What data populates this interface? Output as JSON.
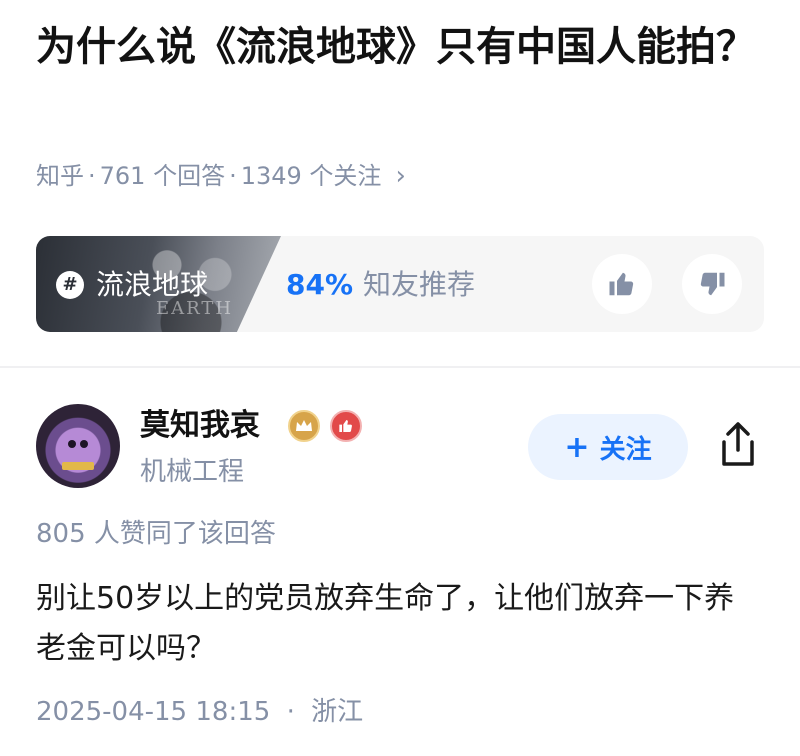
{
  "question": {
    "title": "为什么说《流浪地球》只有中国人能拍？",
    "source": "知乎",
    "answers_count": "761 个回答",
    "followers_count": "1349 个关注",
    "separator": "·"
  },
  "topic": {
    "name": "流浪地球",
    "poster_text": "EARTH",
    "recommend_pct": "84%",
    "recommend_label": "知友推荐",
    "colors": {
      "accent": "#1772f6"
    }
  },
  "author": {
    "name": "莫知我哀",
    "bio": "机械工程",
    "follow_label": "关注",
    "follow_plus": "+"
  },
  "answer": {
    "vote_count": "805 人赞同了该回答",
    "content": "别让50岁以上的党员放弃生命了，让他们放弃一下养老金可以吗？",
    "date": "2025-04-15 18:15",
    "location": "浙江",
    "separator": "·"
  },
  "icons": {
    "meta_chevron": "chevron-right-icon",
    "topic": "hashtag-icon",
    "upvote": "thumbs-up-icon",
    "downvote": "thumbs-down-icon",
    "crown_badge": "crown-badge-icon",
    "like_badge": "like-badge-icon",
    "share": "share-icon"
  }
}
